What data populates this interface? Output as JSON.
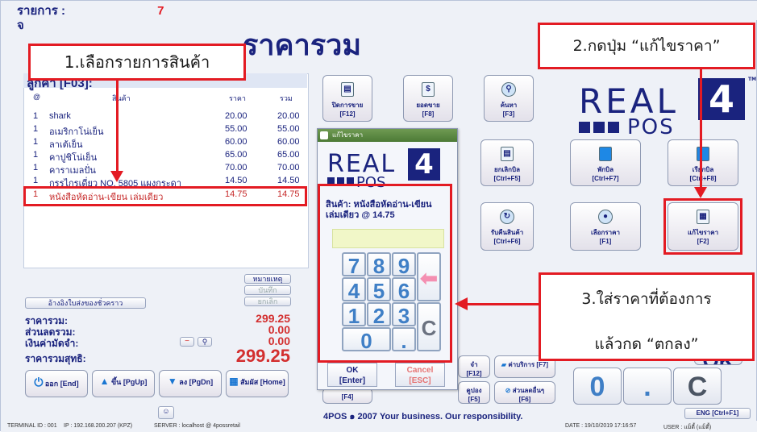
{
  "header": {
    "list_label": "รายการ :",
    "list_count": "7",
    "qty_label": "จ",
    "total_title": "ราคารวม"
  },
  "customer_label": "ลูกค้า [F03]:",
  "columns": {
    "qty": "@",
    "name": "สินค้า",
    "price": "ราคา",
    "total": "รวม"
  },
  "items": [
    {
      "qty": "1",
      "name": "shark",
      "price": "20.00",
      "total": "20.00"
    },
    {
      "qty": "1",
      "name": "อเมริกาโน่เย็น",
      "price": "55.00",
      "total": "55.00"
    },
    {
      "qty": "1",
      "name": "ลาเต้เย็น",
      "price": "60.00",
      "total": "60.00"
    },
    {
      "qty": "1",
      "name": "คาปูชิโน่เย็น",
      "price": "65.00",
      "total": "65.00"
    },
    {
      "qty": "1",
      "name": "คาราเมลปั่น",
      "price": "70.00",
      "total": "70.00"
    },
    {
      "qty": "1",
      "name": "กรรไกรเดี่ยว NO. 5805 แผงกระดา",
      "price": "14.50",
      "total": "14.50"
    },
    {
      "qty": "1",
      "name": "หนังสือหัดอ่าน-เขียน เล่มเดียว",
      "price": "14.75",
      "total": "14.75"
    }
  ],
  "left_buttons": {
    "note": "หมายเหตุ",
    "save": "บันทึก",
    "cancel": "ยกเลิก",
    "ref": "อ้างอิงใบส่งของชั่วคราว"
  },
  "summary": {
    "subtotal_label": "ราคารวม:",
    "subtotal": "299.25",
    "discount_label": "ส่วนลดรวม:",
    "discount": "0.00",
    "deposit_label": "เงินค่ามัดจำ:",
    "deposit": "0.00",
    "net_label": "ราคารวมสุทธิ:",
    "net": "299.25"
  },
  "bottom_left_buttons": [
    {
      "label": "ออก",
      "key": "[End]"
    },
    {
      "label": "ขึ้น",
      "key": "[PgUp]"
    },
    {
      "label": "ลง",
      "key": "[PgDn]"
    },
    {
      "label": "สัมผัส",
      "key": "[Home]"
    }
  ],
  "function_buttons": {
    "close_sale": {
      "label": "ปิดการขาย",
      "key": "[F12]"
    },
    "sales_total": {
      "label": "ยอดขาย",
      "key": "[F8]"
    },
    "search": {
      "label": "ค้นหา",
      "key": "[F3]"
    },
    "cancel_bill": {
      "label": "ยกเลิกบิล",
      "key": "[Ctrl+F5]"
    },
    "hold_bill": {
      "label": "พักบิล",
      "key": "[Ctrl+F7]"
    },
    "recall_bill": {
      "label": "เรียกบิล",
      "key": "[Ctrl+F8]"
    },
    "return_goods": {
      "label": "รับคืนสินค้า",
      "key": "[Ctrl+F6]"
    },
    "select_price": {
      "label": "เลือกราคา",
      "key": "[F1]"
    },
    "edit_price": {
      "label": "แก้ไขราคา",
      "key": "[F2]"
    },
    "fee": {
      "label": "ค่าบริการ",
      "key": "[F7]"
    },
    "other_discount": {
      "label": "ส่วนลดอื่นๆ",
      "key": "[F6]"
    },
    "k12": {
      "label": "จำ",
      "key": "[F12]"
    },
    "coupon": {
      "label": "คูปอง",
      "key": "[F5]"
    },
    "f4": {
      "key": "[F4]"
    }
  },
  "big_keys": {
    "zero": "0",
    "dot": ".",
    "clear": "C",
    "ok": "OK"
  },
  "logo": {
    "real": "REAL",
    "pos": "POS",
    "num": "4",
    "tm": "TM"
  },
  "dialog": {
    "title": "แก้ไขราคา",
    "product_text": "สินค้า: หนังสือหัดอ่าน-เขียน เล่มเดียว @ 14.75",
    "keys": [
      "7",
      "8",
      "9",
      "4",
      "5",
      "6",
      "1",
      "2",
      "3",
      "0",
      "."
    ],
    "clear": "C",
    "ok_label": "OK",
    "ok_key": "[Enter]",
    "cancel_label": "Cancel",
    "cancel_key": "[ESC]"
  },
  "callouts": {
    "step1": "1.เลือกรายการสินค้า",
    "step2": "2.กดปุ่ม “แก้ไขราคา”",
    "step3_line1": "3.ใส่ราคาที่ต้องการ",
    "step3_line2": "แล้วกด “ตกลง”"
  },
  "footer": "4POS ๑ 2007 Your business. Our responsibility.",
  "lang_button": "ENG [Ctrl+F1]",
  "status": {
    "terminal": "TERMINAL ID : 001",
    "ip": "IP : 192.168.200.207 (KPZ)",
    "server": "SERVER : localhost @ 4possretail",
    "datetime": "DATE : 19/10/2019 17:16:57",
    "user": "USER : แม็ตี้ (แม็ตี้)"
  },
  "colors": {
    "accent_red": "#e31b23",
    "navy": "#1a237e",
    "price_red": "#d32f2f"
  }
}
